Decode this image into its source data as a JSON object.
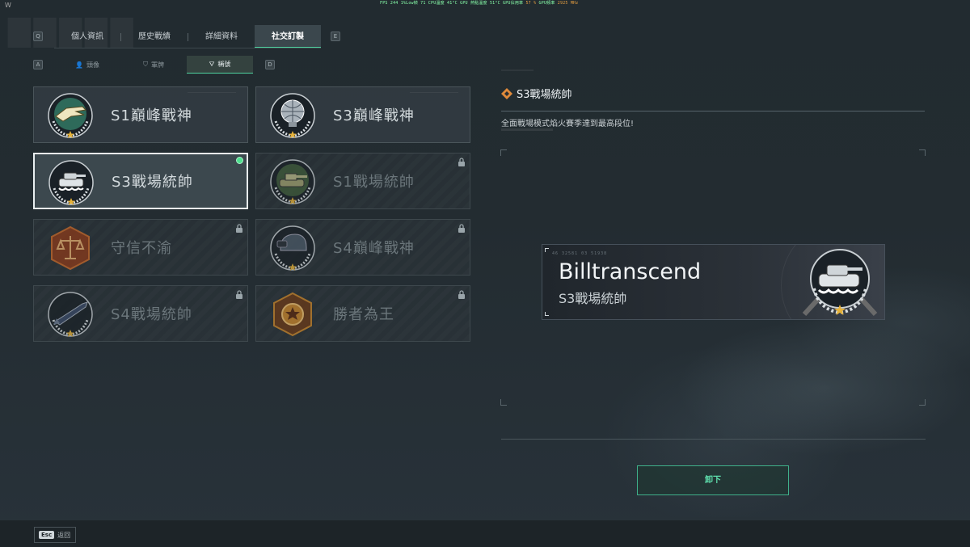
{
  "perf_overlay": {
    "fps_label": "FPS",
    "fps_value": "244",
    "rest": "1%Low幀   71   CPU溫度   41°C   GPU 熱點溫度   51°C   GPU佔用率",
    "gpu_usage": "57 %",
    "gpu_freq_label": "GPU頻率",
    "gpu_freq": "2925 MHz"
  },
  "corner_char": "W",
  "key_hints": {
    "q": "Q",
    "e": "E",
    "a": "A",
    "d": "D"
  },
  "tabs": [
    {
      "label": "個人資訊"
    },
    {
      "label": "歷史戰績"
    },
    {
      "label": "詳細資料"
    },
    {
      "label": "社交訂製"
    }
  ],
  "subtabs": [
    {
      "label": "頭像",
      "icon": "person-icon"
    },
    {
      "label": "軍牌",
      "icon": "dogtag-icon"
    },
    {
      "label": "稱號",
      "icon": "title-icon"
    }
  ],
  "titles": [
    {
      "name": "S1巔峰戰神",
      "emblem": "crocodile-emblem",
      "locked": false,
      "selected": false
    },
    {
      "name": "S3巔峰戰神",
      "emblem": "globe-emblem",
      "locked": false,
      "selected": false
    },
    {
      "name": "S3戰場統帥",
      "emblem": "tank-emblem",
      "locked": false,
      "selected": true
    },
    {
      "name": "S1戰場統帥",
      "emblem": "tank-green-emblem",
      "locked": true,
      "selected": false
    },
    {
      "name": "守信不渝",
      "emblem": "scales-emblem",
      "locked": true,
      "selected": false
    },
    {
      "name": "S4巔峰戰神",
      "emblem": "helmet-emblem",
      "locked": true,
      "selected": false
    },
    {
      "name": "S4戰場統帥",
      "emblem": "missile-emblem",
      "locked": true,
      "selected": false
    },
    {
      "name": "勝者為王",
      "emblem": "medal-emblem",
      "locked": true,
      "selected": false
    }
  ],
  "detail": {
    "title": "S3戰場統帥",
    "description": "全面戰場模式焰火賽季達到最高段位!"
  },
  "nameplate": {
    "code": "46 32581 03 51938",
    "player_name": "Billtranscend",
    "title": "S3戰場統帥"
  },
  "unequip_label": "卸下",
  "footer": {
    "esc_key": "Esc",
    "back_label": "返回"
  },
  "colors": {
    "accent": "#4fd3a0",
    "equipped_dot": "#4fe08f",
    "diamond_icon": "#e08a3a"
  }
}
